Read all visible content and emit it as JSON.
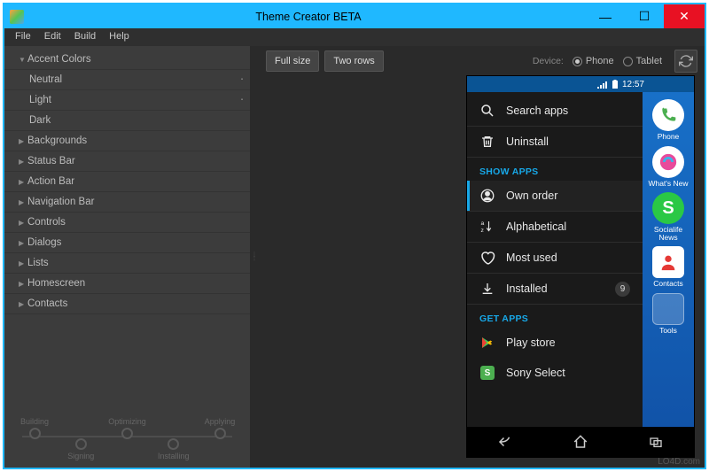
{
  "window": {
    "title": "Theme Creator BETA"
  },
  "menu": [
    "File",
    "Edit",
    "Build",
    "Help"
  ],
  "sidebar": {
    "accent": {
      "label": "Accent Colors",
      "items": [
        "Neutral",
        "Light",
        "Dark"
      ]
    },
    "groups": [
      "Backgrounds",
      "Status Bar",
      "Action Bar",
      "Navigation Bar",
      "Controls",
      "Dialogs",
      "Lists",
      "Homescreen",
      "Contacts"
    ]
  },
  "progress": {
    "steps": [
      "Building",
      "Signing",
      "Optimizing",
      "Installing",
      "Applying"
    ]
  },
  "toolbar": {
    "full_size": "Full size",
    "two_rows": "Two rows",
    "device_label": "Device:",
    "phone": "Phone",
    "tablet": "Tablet"
  },
  "phone": {
    "time": "12:57",
    "search": "Search apps",
    "uninstall": "Uninstall",
    "sections": {
      "show": "SHOW APPS",
      "get": "GET APPS"
    },
    "show_apps": {
      "own_order": "Own order",
      "alphabetical": "Alphabetical",
      "most_used": "Most used",
      "installed": "Installed",
      "installed_count": "9"
    },
    "get_apps": {
      "play_store": "Play store",
      "sony_select": "Sony Select"
    },
    "rail": {
      "phone": "Phone",
      "whats_new": "What's New",
      "socialife": "Socialife News",
      "contacts": "Contacts",
      "tools": "Tools"
    }
  },
  "watermark": "LO4D.com"
}
